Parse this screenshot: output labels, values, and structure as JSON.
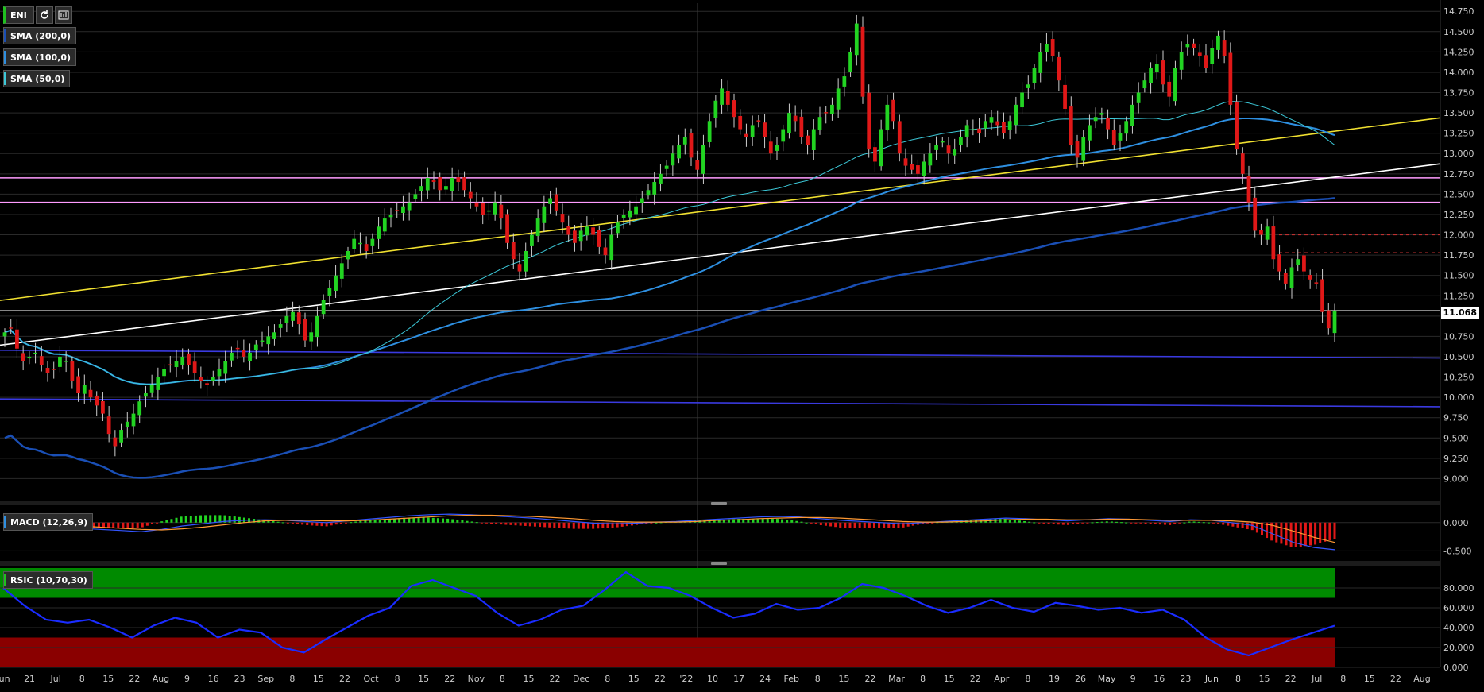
{
  "toolbar": {
    "symbol": "ENI",
    "refresh_icon": "refresh-icon",
    "chart_icon": "chart-settings-icon"
  },
  "legends": {
    "sma200": {
      "label": "SMA (200,0)",
      "color": "#1a4fb5"
    },
    "sma100": {
      "label": "SMA (100,0)",
      "color": "#2e8fe0"
    },
    "sma50": {
      "label": "SMA (50,0)",
      "color": "#3cc8d8"
    },
    "macd": {
      "label": "MACD (12,26,9)",
      "color": "#2e8fe0"
    },
    "rsic": {
      "label": "RSIC (10,70,30)",
      "color": "#20c020"
    }
  },
  "current_price": "11.068",
  "chart_data": {
    "type": "candlestick",
    "price_axis": {
      "ticks": [
        "14.750",
        "14.500",
        "14.250",
        "14.000",
        "13.750",
        "13.500",
        "13.250",
        "13.000",
        "12.750",
        "12.500",
        "12.250",
        "12.000",
        "11.750",
        "11.500",
        "11.250",
        "11.000",
        "10.750",
        "10.500",
        "10.250",
        "10.000",
        "9.750",
        "9.500",
        "9.250",
        "9.000"
      ],
      "ylim": [
        8.75,
        14.85
      ]
    },
    "macd_axis": {
      "ticks": [
        "0.000",
        "-0.500"
      ]
    },
    "rsi_axis": {
      "ticks": [
        "80.000",
        "60.000",
        "40.000",
        "20.000",
        "0.000"
      ],
      "ylim": [
        0,
        100
      ],
      "overbought": 70,
      "oversold": 30
    },
    "x_labels": [
      "Jun",
      "21",
      "Jul",
      "8",
      "15",
      "22",
      "Aug",
      "9",
      "16",
      "23",
      "Sep",
      "8",
      "15",
      "22",
      "Oct",
      "8",
      "15",
      "22",
      "Nov",
      "8",
      "15",
      "22",
      "Dec",
      "8",
      "15",
      "22",
      "'22",
      "10",
      "17",
      "24",
      "Feb",
      "8",
      "15",
      "22",
      "Mar",
      "8",
      "15",
      "22",
      "Apr",
      "8",
      "19",
      "26",
      "May",
      "9",
      "16",
      "23",
      "Jun",
      "8",
      "15",
      "22",
      "Jul",
      "8",
      "15",
      "22",
      "Aug"
    ],
    "horizontal_levels": [
      {
        "value": 12.7,
        "color": "#ff9cff"
      },
      {
        "value": 12.4,
        "color": "#ff9cff"
      },
      {
        "value": 11.068,
        "color": "#999999"
      }
    ],
    "dashed_levels": [
      {
        "value": 12.0,
        "color": "#c03030"
      },
      {
        "value": 11.78,
        "color": "#c03030"
      }
    ],
    "trendlines": [
      {
        "color": "#f0e030",
        "start_index": 0,
        "start": 11.2,
        "end_index": 295,
        "end": 14.02
      },
      {
        "color": "#ffffff",
        "start_index": 0,
        "start": 10.65,
        "end_index": 295,
        "end": 13.45
      },
      {
        "color": "#3a3ae0",
        "start_index": 0,
        "start": 10.58,
        "end_index": 295,
        "end": 10.46
      },
      {
        "color": "#3a3ae0",
        "start_index": 0,
        "start": 9.98,
        "end_index": 295,
        "end": 9.86
      }
    ],
    "series": [
      {
        "name": "Close",
        "values": [
          10.8,
          10.85,
          10.6,
          10.45,
          10.5,
          10.55,
          10.4,
          10.3,
          10.35,
          10.5,
          10.45,
          10.2,
          10.05,
          10.15,
          10.0,
          9.9,
          9.8,
          9.55,
          9.4,
          9.6,
          9.7,
          9.8,
          9.95,
          10.05,
          10.15,
          10.25,
          10.35,
          10.4,
          10.45,
          10.5,
          10.4,
          10.3,
          10.2,
          10.15,
          10.25,
          10.35,
          10.45,
          10.55,
          10.6,
          10.5,
          10.55,
          10.65,
          10.7,
          10.75,
          10.8,
          10.9,
          11.0,
          11.05,
          10.9,
          10.7,
          10.8,
          11.0,
          11.2,
          11.35,
          11.5,
          11.65,
          11.8,
          11.95,
          11.9,
          11.8,
          11.95,
          12.1,
          12.2,
          12.25,
          12.3,
          12.35,
          12.4,
          12.5,
          12.6,
          12.7,
          12.65,
          12.55,
          12.6,
          12.7,
          12.65,
          12.55,
          12.45,
          12.35,
          12.25,
          12.3,
          12.4,
          12.2,
          11.9,
          11.7,
          11.55,
          11.8,
          12.0,
          12.2,
          12.35,
          12.45,
          12.3,
          12.15,
          12.0,
          11.9,
          12.05,
          12.1,
          12.0,
          11.85,
          11.75,
          12.0,
          12.15,
          12.25,
          12.3,
          12.35,
          12.45,
          12.55,
          12.65,
          12.75,
          12.85,
          13.0,
          13.1,
          13.2,
          12.95,
          12.8,
          13.1,
          13.4,
          13.65,
          13.8,
          13.6,
          13.45,
          13.3,
          13.2,
          13.35,
          13.4,
          13.2,
          13.0,
          13.1,
          13.3,
          13.5,
          13.4,
          13.2,
          13.1,
          13.3,
          13.45,
          13.5,
          13.6,
          13.8,
          13.95,
          14.25,
          14.6,
          13.7,
          13.05,
          12.9,
          13.3,
          13.6,
          13.4,
          13.0,
          12.85,
          12.8,
          12.75,
          12.9,
          13.0,
          13.1,
          13.15,
          13.0,
          13.05,
          13.2,
          13.35,
          13.3,
          13.25,
          13.4,
          13.45,
          13.35,
          13.25,
          13.4,
          13.6,
          13.75,
          13.85,
          14.05,
          14.25,
          14.35,
          14.2,
          13.9,
          13.55,
          13.1,
          12.95,
          13.2,
          13.35,
          13.45,
          13.5,
          13.3,
          13.1,
          13.25,
          13.4,
          13.6,
          13.75,
          13.9,
          14.05,
          14.1,
          13.85,
          13.7,
          14.05,
          14.25,
          14.35,
          14.3,
          14.2,
          14.05,
          14.3,
          14.45,
          14.2,
          13.6,
          13.05,
          12.75,
          12.4,
          12.05,
          12.0,
          12.1,
          11.7,
          11.55,
          11.4,
          11.6,
          11.7,
          11.55,
          11.45,
          11.4,
          11.05,
          10.85,
          11.068
        ]
      }
    ],
    "macd": {
      "line": [
        -0.1,
        -0.12,
        -0.14,
        -0.16,
        -0.12,
        -0.06,
        -0.02,
        0.02,
        0.04,
        0.05,
        0.04,
        0.02,
        0.0,
        0.03,
        0.06,
        0.09,
        0.12,
        0.14,
        0.15,
        0.14,
        0.12,
        0.1,
        0.08,
        0.05,
        0.02,
        -0.01,
        -0.02,
        -0.01,
        0.01,
        0.02,
        0.04,
        0.06,
        0.08,
        0.1,
        0.11,
        0.1,
        0.07,
        0.04,
        0.02,
        0.0,
        -0.02,
        0.0,
        0.02,
        0.04,
        0.06,
        0.08,
        0.07,
        0.05,
        0.03,
        0.05,
        0.07,
        0.06,
        0.04,
        0.02,
        0.05,
        0.04,
        0.0,
        -0.05,
        -0.2,
        -0.35,
        -0.44,
        -0.48
      ],
      "signal": [
        -0.06,
        -0.08,
        -0.1,
        -0.12,
        -0.13,
        -0.11,
        -0.08,
        -0.04,
        0.0,
        0.03,
        0.04,
        0.04,
        0.03,
        0.03,
        0.04,
        0.06,
        0.08,
        0.1,
        0.12,
        0.13,
        0.13,
        0.12,
        0.11,
        0.09,
        0.07,
        0.04,
        0.02,
        0.01,
        0.01,
        0.01,
        0.02,
        0.04,
        0.05,
        0.07,
        0.08,
        0.09,
        0.09,
        0.08,
        0.06,
        0.04,
        0.02,
        0.01,
        0.01,
        0.02,
        0.03,
        0.05,
        0.06,
        0.06,
        0.05,
        0.05,
        0.06,
        0.06,
        0.05,
        0.04,
        0.04,
        0.04,
        0.03,
        0.01,
        -0.05,
        -0.15,
        -0.26,
        -0.35
      ]
    },
    "rsi": [
      80,
      62,
      48,
      45,
      48,
      40,
      30,
      42,
      50,
      45,
      30,
      38,
      35,
      20,
      15,
      28,
      40,
      52,
      60,
      82,
      88,
      80,
      72,
      55,
      42,
      48,
      58,
      62,
      78,
      96,
      82,
      80,
      72,
      60,
      50,
      54,
      64,
      58,
      60,
      70,
      84,
      80,
      72,
      62,
      55,
      60,
      68,
      60,
      56,
      65,
      62,
      58,
      60,
      55,
      58,
      48,
      30,
      18,
      12,
      20,
      28,
      35,
      42
    ]
  }
}
